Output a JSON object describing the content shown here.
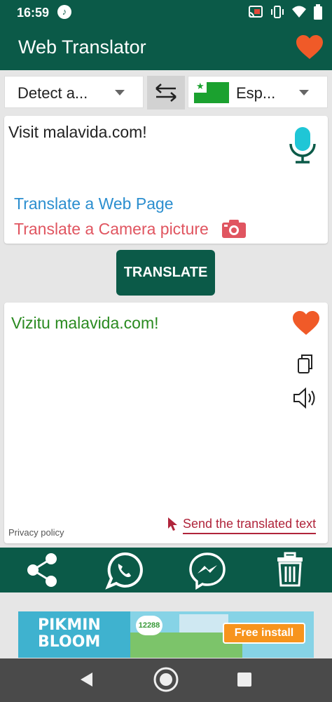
{
  "status_bar": {
    "time": "16:59"
  },
  "app_bar": {
    "title": "Web Translator"
  },
  "language": {
    "source_label": "Detect a...",
    "target_label": "Esp..."
  },
  "input": {
    "text": "Visit malavida.com!",
    "translate_web_page": "Translate a Web Page",
    "translate_camera": "Translate a Camera picture"
  },
  "translate_button": "TRANSLATE",
  "output": {
    "text": "Vizitu malavida.com!",
    "privacy": "Privacy policy",
    "send": "Send the translated text"
  },
  "ad": {
    "brand_line1": "PIKMIN",
    "brand_line2": "BLOOM",
    "count": "12288",
    "cta": "Free install"
  },
  "colors": {
    "primary": "#0b5a48",
    "heart": "#f05a28",
    "link_blue": "#2b8ecf",
    "link_red": "#e05560",
    "output_green": "#2a8a20",
    "send_red": "#b0243b"
  },
  "icons": [
    "music-icon",
    "cast-icon",
    "vibrate-icon",
    "wifi-icon",
    "battery-icon",
    "heart-icon",
    "swap-icon",
    "microphone-icon",
    "camera-icon",
    "copy-icon",
    "speaker-icon",
    "share-icon",
    "whatsapp-icon",
    "messenger-icon",
    "trash-icon",
    "back-icon",
    "home-icon",
    "recents-icon"
  ]
}
